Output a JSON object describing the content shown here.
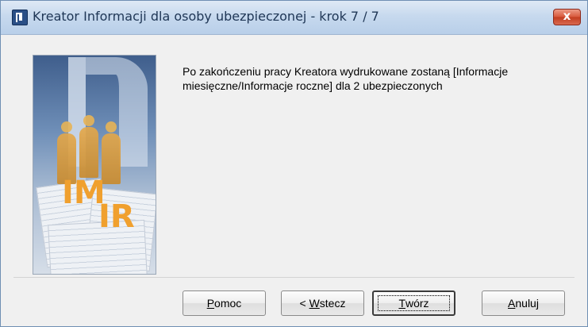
{
  "window": {
    "title": "Kreator Informacji dla osoby ubezpieczonej  - krok 7 / 7",
    "close_label": "x"
  },
  "illustration": {
    "label_im": "IM",
    "label_ir": "IR"
  },
  "message": {
    "line1": "Po zakończeniu pracy Kreatora wydrukowane zostaną [Informacje",
    "line2": "miesięczne/Informacje roczne] dla 2 ubezpieczonych"
  },
  "buttons": {
    "help": {
      "pre": "",
      "mnemonic": "P",
      "post": "omoc"
    },
    "back": {
      "pre": "< ",
      "mnemonic": "W",
      "post": "stecz"
    },
    "create": {
      "pre": "",
      "mnemonic": "T",
      "post": "wórz"
    },
    "cancel": {
      "pre": "",
      "mnemonic": "A",
      "post": "nuluj"
    }
  },
  "colors": {
    "title_gradient": "#c7d9ee",
    "close_button": "#d8583b",
    "illustration_accent": "#f0a02e"
  }
}
